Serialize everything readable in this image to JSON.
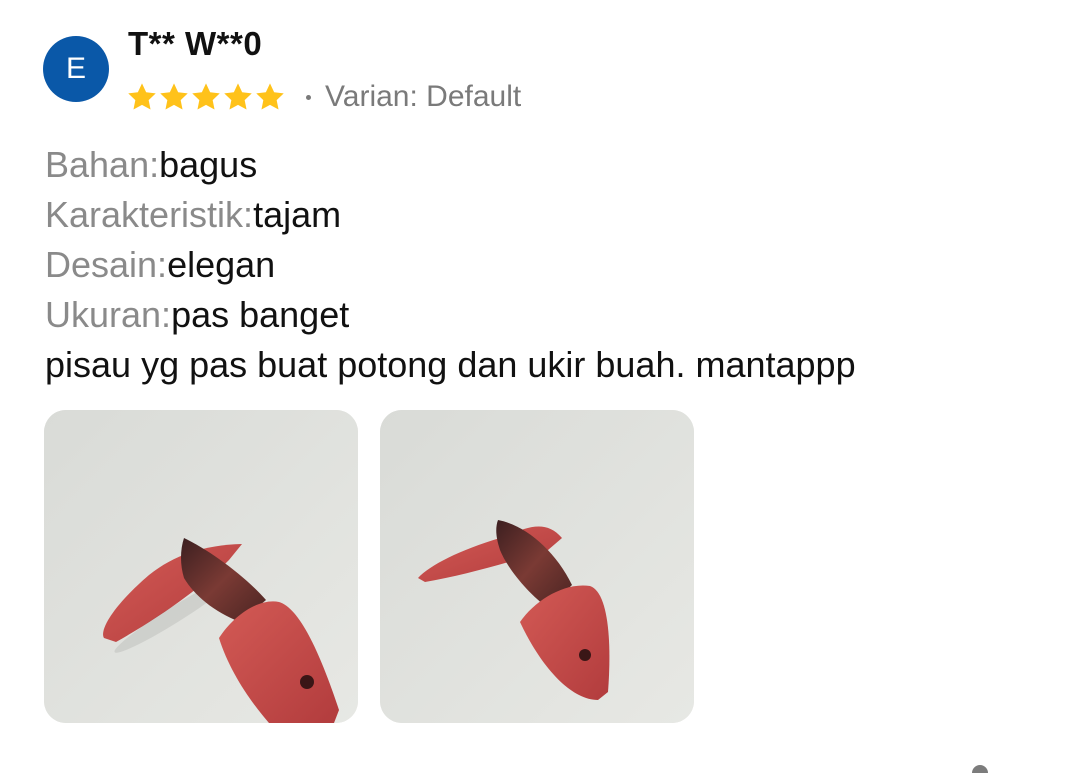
{
  "review": {
    "avatar_letter": "E",
    "username": "T** W**0",
    "rating": 5,
    "variant": "Varian: Default",
    "attributes": [
      {
        "key": "Bahan:",
        "value": "bagus"
      },
      {
        "key": "Karakteristik:",
        "value": "tajam"
      },
      {
        "key": "Desain:",
        "value": "elegan"
      },
      {
        "key": "Ukuran:",
        "value": "pas banget"
      }
    ],
    "comment": "pisau yg pas buat potong dan ukir buah. mantappp",
    "photo_count": 2
  },
  "colors": {
    "avatar_bg": "#0a58a8",
    "star": "#ffc21a",
    "muted_text": "#8a8a8a",
    "photo_bg": "#e1e2de",
    "wood": "#c44a48"
  },
  "icons": {
    "star": "star-icon",
    "photos": "knife-photo"
  }
}
